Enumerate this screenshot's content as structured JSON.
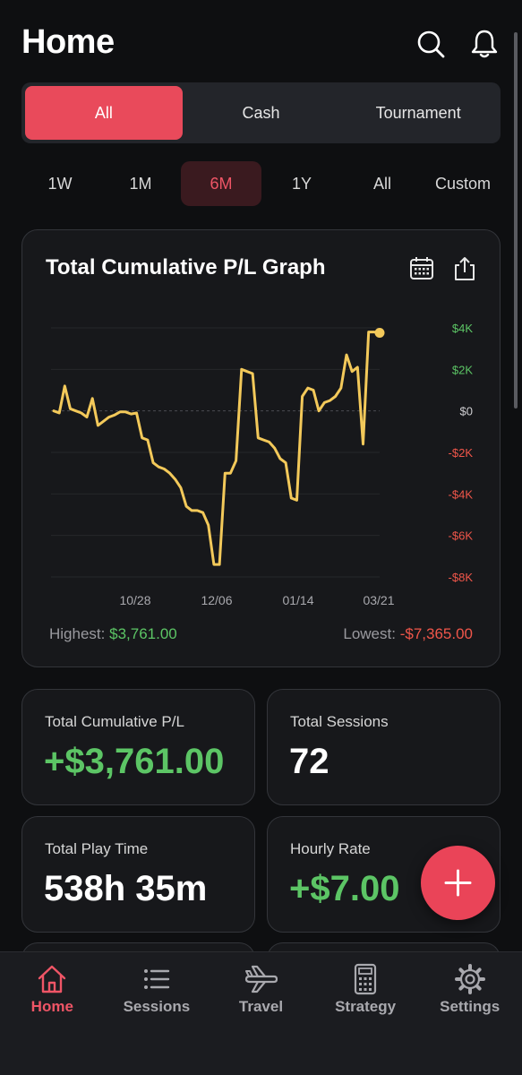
{
  "header": {
    "title": "Home",
    "search_icon": "search-icon",
    "notification_icon": "bell-icon"
  },
  "game_filter": {
    "items": [
      "All",
      "Cash",
      "Tournament"
    ],
    "selected": "All"
  },
  "time_ranges": {
    "items": [
      "1W",
      "1M",
      "6M",
      "1Y",
      "All",
      "Custom"
    ],
    "selected": "6M"
  },
  "graph_card": {
    "title": "Total Cumulative P/L Graph",
    "calendar_icon": "calendar-icon",
    "share_icon": "share-icon",
    "highest_label": "Highest:",
    "highest_value": "$3,761.00",
    "lowest_label": "Lowest:",
    "lowest_value": "-$7,365.00"
  },
  "chart_data": {
    "type": "line",
    "title": "Total Cumulative P/L Graph",
    "x_tick_labels": [
      "10/28",
      "12/06",
      "01/14",
      "03/21"
    ],
    "y_tick_labels": [
      "$4K",
      "$2K",
      "$0",
      "-$2K",
      "-$4K",
      "-$6K",
      "-$8K"
    ],
    "y_tick_values": [
      4000,
      2000,
      0,
      -2000,
      -4000,
      -6000,
      -8000
    ],
    "ylim": [
      -8000,
      4000
    ],
    "colors": {
      "line": "#f3c95a",
      "positive": "#5cc565",
      "negative": "#f0564a"
    },
    "series": [
      {
        "values": [
          0,
          -100,
          1200,
          100,
          0,
          -100,
          -300,
          600,
          -700,
          -500,
          -300,
          -200,
          -50,
          -50,
          -150,
          -100,
          -1300,
          -1400,
          -2500,
          -2700,
          -2800,
          -3000,
          -3300,
          -3700,
          -4600,
          -4800,
          -4800,
          -4900,
          -5500,
          -7400,
          -7400,
          -3000,
          -3000,
          -2400,
          2000,
          1900,
          1800,
          -1300,
          -1400,
          -1500,
          -1800,
          -2300,
          -2500,
          -4200,
          -4300,
          700,
          1100,
          1000,
          0,
          400,
          500,
          700,
          1100,
          2700,
          1900,
          2100,
          -1600,
          3800,
          3800,
          3761
        ]
      }
    ],
    "last_point_marked": true,
    "grid": true,
    "zero_line_dashed": true
  },
  "stats": [
    {
      "label": "Total Cumulative P/L",
      "value": "+$3,761.00",
      "tone": "positive"
    },
    {
      "label": "Total Sessions",
      "value": "72",
      "tone": "neutral"
    },
    {
      "label": "Total Play Time",
      "value": "538h 35m",
      "tone": "neutral"
    },
    {
      "label": "Hourly Rate",
      "value": "+$7.00",
      "tone": "positive"
    }
  ],
  "fab": {
    "icon": "plus-icon"
  },
  "tabbar": {
    "items": [
      {
        "label": "Home",
        "icon": "home-icon",
        "active": true
      },
      {
        "label": "Sessions",
        "icon": "list-icon",
        "active": false
      },
      {
        "label": "Travel",
        "icon": "airplane-icon",
        "active": false
      },
      {
        "label": "Strategy",
        "icon": "calculator-icon",
        "active": false
      },
      {
        "label": "Settings",
        "icon": "gear-icon",
        "active": false
      }
    ]
  }
}
